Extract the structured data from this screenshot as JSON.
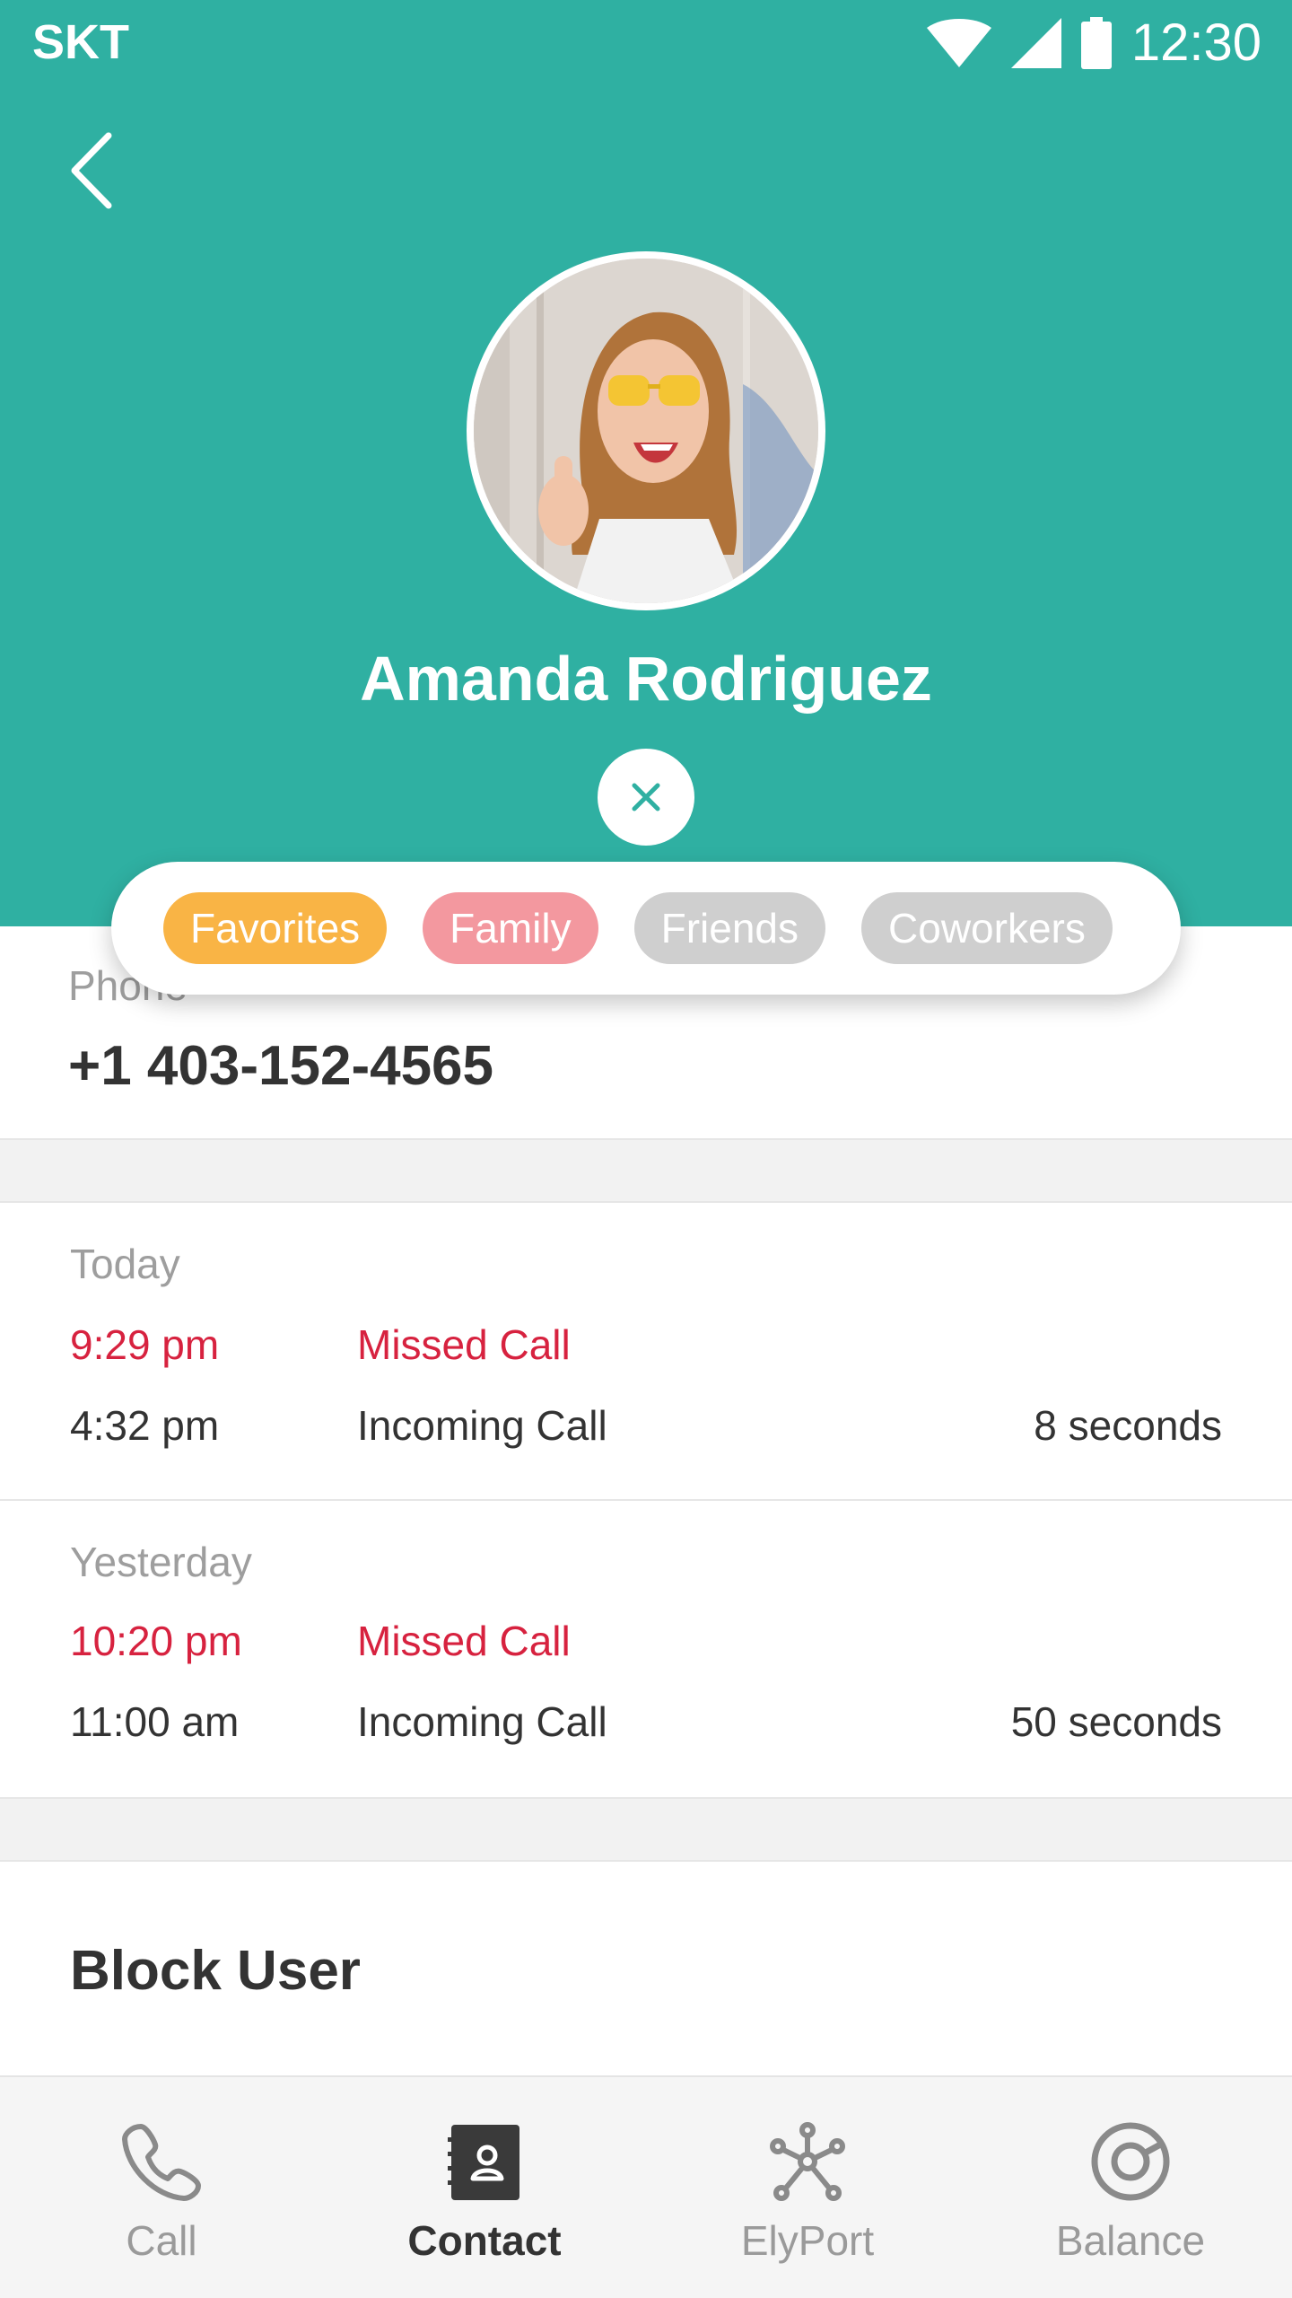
{
  "status_bar": {
    "carrier": "SKT",
    "time": "12:30",
    "icons": [
      "wifi-icon",
      "signal-icon",
      "battery-icon"
    ]
  },
  "header": {
    "back_icon": "chevron-left-icon",
    "background_color": "#2fb0a2"
  },
  "contact": {
    "name": "Amanda Rodriguez",
    "phone_label": "Phone",
    "phone_number": "+1 403-152-4565"
  },
  "tags": [
    {
      "label": "Favorites",
      "color": "#f9b445"
    },
    {
      "label": "Family",
      "color": "#f3989f"
    },
    {
      "label": "Friends",
      "color": "#cfcfcf"
    },
    {
      "label": "Coworkers",
      "color": "#cfcfcf"
    }
  ],
  "history": [
    {
      "date": "Today",
      "calls": [
        {
          "time": "9:29 pm",
          "type": "Missed Call",
          "duration": "",
          "missed": true
        },
        {
          "time": "4:32 pm",
          "type": "Incoming Call",
          "duration": "8 seconds",
          "missed": false
        }
      ]
    },
    {
      "date": "Yesterday",
      "calls": [
        {
          "time": "10:20 pm",
          "type": "Missed Call",
          "duration": "",
          "missed": true
        },
        {
          "time": "11:00 am",
          "type": "Incoming Call",
          "duration": "50 seconds",
          "missed": false
        }
      ]
    }
  ],
  "actions": {
    "block_label": "Block User"
  },
  "bottom_nav": [
    {
      "label": "Call",
      "icon": "phone-icon",
      "active": false
    },
    {
      "label": "Contact",
      "icon": "contact-book-icon",
      "active": true
    },
    {
      "label": "ElyPort",
      "icon": "network-icon",
      "active": false
    },
    {
      "label": "Balance",
      "icon": "balance-icon",
      "active": false
    }
  ]
}
